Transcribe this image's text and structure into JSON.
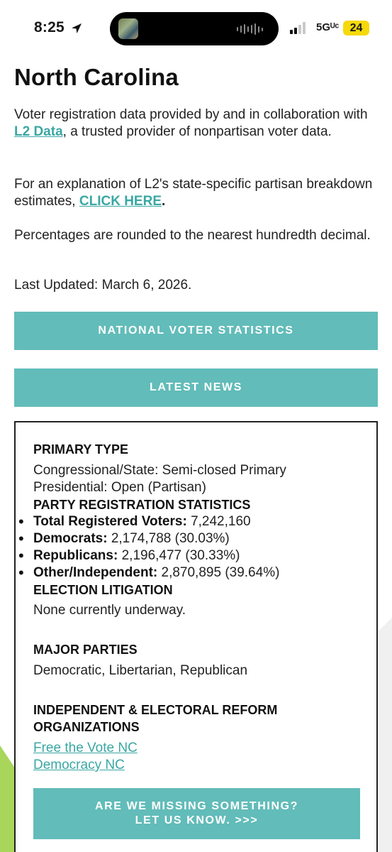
{
  "status_bar": {
    "time": "8:25",
    "network": "5Gᵁᶜ",
    "battery": "24",
    "colors": {
      "battery": "#f5d90a"
    }
  },
  "page": {
    "title": "North Carolina",
    "intro_before_link": "Voter registration data provided by and in collaboration with ",
    "intro_link": "L2 Data",
    "intro_after_link": ", a trusted provider of nonpartisan voter data.",
    "explain_before_link": "For an explanation of L2's state-specific partisan breakdown estimates, ",
    "explain_link": "CLICK HERE",
    "explain_after_link": ".",
    "rounding_note": "Percentages are rounded to the nearest hundredth decimal.",
    "last_updated": "Last Updated: March 6, 2026.",
    "colors": {
      "accent": "#62bcb9",
      "link": "#3aa7a3"
    }
  },
  "buttons": {
    "national": "NATIONAL VOTER STATISTICS",
    "news": "LATEST NEWS"
  },
  "card": {
    "primary_type_heading": "PRIMARY TYPE",
    "primary_congressional": "Congressional/State: Semi-closed Primary",
    "primary_presidential": "Presidential: Open (Partisan)",
    "party_stats_heading": "PARTY REGISTRATION STATISTICS",
    "stats": [
      {
        "label": "Total Registered Voters:",
        "value": "7,242,160"
      },
      {
        "label": "Democrats:",
        "value": "2,174,788 (30.03%)"
      },
      {
        "label": "Republicans:",
        "value": "2,196,477 (30.33%)"
      },
      {
        "label": "Other/Independent:",
        "value": "2,870,895 (39.64%)"
      }
    ],
    "litigation_heading": "ELECTION LITIGATION",
    "litigation_text": "None currently underway.",
    "major_parties_heading": "MAJOR PARTIES",
    "major_parties_text": "Democratic, Libertarian, Republican",
    "orgs_heading": "INDEPENDENT & ELECTORAL REFORM ORGANIZATIONS",
    "orgs": [
      "Free the Vote NC",
      "Democracy NC"
    ],
    "missing_line1": "ARE WE MISSING SOMETHING?",
    "missing_line2": "LET US KNOW. >>>"
  }
}
